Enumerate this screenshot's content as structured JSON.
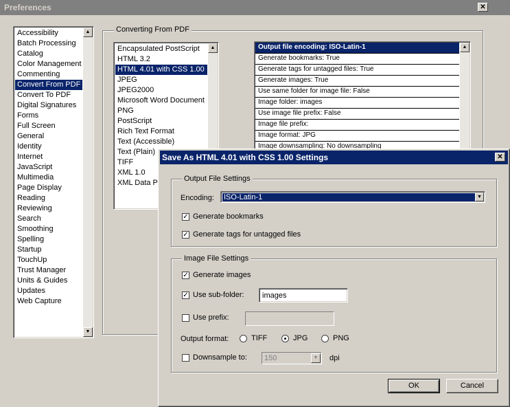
{
  "window": {
    "title": "Preferences",
    "close_glyph": "✕"
  },
  "categories": {
    "items": [
      "Accessibility",
      "Batch Processing",
      "Catalog",
      "Color Management",
      "Commenting",
      "Convert From PDF",
      "Convert To PDF",
      "Digital Signatures",
      "Forms",
      "Full Screen",
      "General",
      "Identity",
      "Internet",
      "JavaScript",
      "Multimedia",
      "Page Display",
      "Reading",
      "Reviewing",
      "Search",
      "Smoothing",
      "Spelling",
      "Startup",
      "TouchUp",
      "Trust Manager",
      "Units & Guides",
      "Updates",
      "Web Capture"
    ],
    "selected": "Convert From PDF"
  },
  "converting": {
    "group_label": "Converting From PDF",
    "formats": [
      "Encapsulated PostScript",
      "HTML 3.2",
      "HTML 4.01 with CSS 1.00",
      "JPEG",
      "JPEG2000",
      "Microsoft Word Document",
      "PNG",
      "PostScript",
      "Rich Text Format",
      "Text (Accessible)",
      "Text (Plain)",
      "TIFF",
      "XML 1.0",
      "XML Data Pa"
    ],
    "selected_format": "HTML 4.01 with CSS 1.00",
    "settings": [
      "Output file encoding: ISO-Latin-1",
      "Generate bookmarks: True",
      "Generate tags for untagged files: True",
      "Generate images: True",
      "Use same folder for image file: False",
      "Image folder: images",
      "Use image file prefix: False",
      "Image file prefix:",
      "Image format: JPG",
      "Image downsampling: No downsampling"
    ]
  },
  "dialog": {
    "title": "Save As HTML 4.01 with CSS 1.00 Settings",
    "close_glyph": "✕",
    "output_group": "Output File Settings",
    "encoding_label": "Encoding:",
    "encoding_value": "ISO-Latin-1",
    "generate_bookmarks": "Generate bookmarks",
    "generate_tags": "Generate tags for untagged files",
    "image_group": "Image File Settings",
    "generate_images": "Generate images",
    "use_subfolder": "Use sub-folder:",
    "subfolder_value": "images",
    "use_prefix": "Use prefix:",
    "prefix_value": "",
    "output_format_label": "Output format:",
    "format_tiff": "TIFF",
    "format_jpg": "JPG",
    "format_png": "PNG",
    "downsample_label": "Downsample to:",
    "downsample_value": "150",
    "dpi_label": "dpi",
    "ok": "OK",
    "cancel": "Cancel",
    "check_glyph": "✓",
    "arrow_down_glyph": "▼",
    "arrow_up_glyph": "▲"
  }
}
